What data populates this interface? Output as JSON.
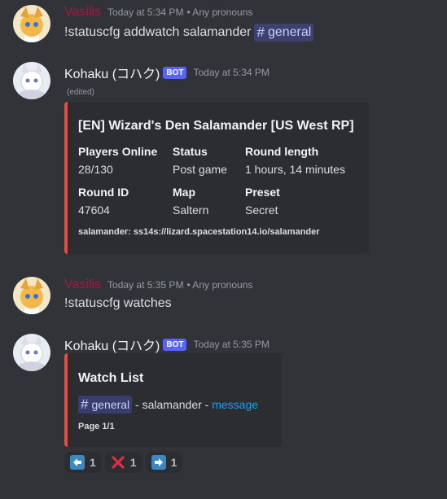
{
  "messages": [
    {
      "username": "Vasilis",
      "timestamp": "Today at 5:34 PM",
      "pronouns": "• Any pronouns",
      "text": "!statuscfg addwatch salamander",
      "mention": "general"
    },
    {
      "username": "Kohaku (コハク)",
      "bot_tag": "BOT",
      "timestamp": "Today at 5:34 PM",
      "edited": "(edited)",
      "embed": {
        "title": "[EN] Wizard's Den Salamander [US West RP]",
        "fields": [
          {
            "name": "Players Online",
            "value": "28/130"
          },
          {
            "name": "Status",
            "value": "Post game"
          },
          {
            "name": "Round length",
            "value": "1 hours, 14 minutes"
          },
          {
            "name": "Round ID",
            "value": "47604"
          },
          {
            "name": "Map",
            "value": "Saltern"
          },
          {
            "name": "Preset",
            "value": "Secret"
          }
        ],
        "footer": "salamander: ss14s://lizard.spacestation14.io/salamander",
        "border_color": "#e74c3c"
      }
    },
    {
      "username": "Vasilis",
      "timestamp": "Today at 5:35 PM",
      "pronouns": "• Any pronouns",
      "text": "!statuscfg watches"
    },
    {
      "username": "Kohaku (コハク)",
      "bot_tag": "BOT",
      "timestamp": "Today at 5:35 PM",
      "embed": {
        "title": "Watch List",
        "mention": "general",
        "desc_mid": " - salamander - ",
        "desc_link": "message",
        "footer": "Page 1/1",
        "border_color": "#e74c3c"
      },
      "reactions": [
        {
          "icon": "arrow-left-icon",
          "count": "1"
        },
        {
          "icon": "cross-mark-icon",
          "count": "1"
        },
        {
          "icon": "arrow-right-icon",
          "count": "1"
        }
      ]
    }
  ],
  "colors": {
    "background": "#313338",
    "vasilis_name": "#a61a3c",
    "bot_tag": "#5865f2",
    "link": "#00a8fc",
    "embed_bg": "#2b2d31"
  }
}
